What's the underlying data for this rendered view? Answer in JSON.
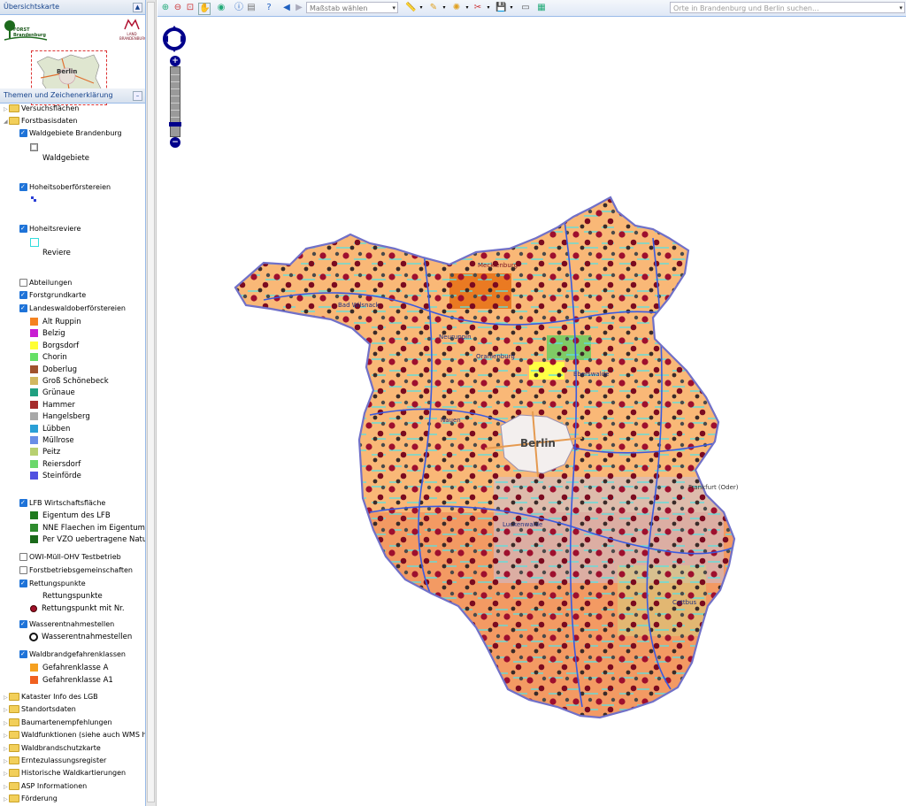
{
  "overview": {
    "title": "Übersichtskarte",
    "logo_forst_text": "FORST Brandenburg",
    "logo_unesco_text": "LAND BRANDENBURG",
    "mini_city": "Berlin"
  },
  "themes": {
    "title": "Themen und Zeichenerklärung"
  },
  "tree": [
    {
      "type": "folder",
      "label": "Versuchsflächen",
      "expanded": false
    },
    {
      "type": "folder",
      "label": "Forstbasisdaten",
      "expanded": true
    },
    {
      "type": "layer",
      "label": "Waldgebiete Brandenburg",
      "checked": true
    },
    {
      "type": "legend",
      "label": "Waldgebiete",
      "color": "#ffffff",
      "border": "#777777"
    },
    {
      "type": "layer",
      "label": "Hoheitsoberförstereien",
      "checked": true
    },
    {
      "type": "layer",
      "label": "Hoheitsreviere",
      "checked": true
    },
    {
      "type": "legend",
      "label": "Reviere",
      "color": "#ffffff",
      "border": "#33dddd"
    },
    {
      "type": "layer",
      "label": "Abteilungen",
      "checked": false
    },
    {
      "type": "layer",
      "label": "Forstgrundkarte",
      "checked": true
    },
    {
      "type": "layer",
      "label": "Landeswaldoberförstereien",
      "checked": true
    }
  ],
  "landeswald_legend": [
    {
      "label": "Alt Ruppin",
      "color": "#f58220"
    },
    {
      "label": "Belzig",
      "color": "#c81ed2"
    },
    {
      "label": "Borgsdorf",
      "color": "#ffff33"
    },
    {
      "label": "Chorin",
      "color": "#66e066"
    },
    {
      "label": "Doberlug",
      "color": "#a0522d"
    },
    {
      "label": "Groß Schönebeck",
      "color": "#d2b860"
    },
    {
      "label": "Grünaue",
      "color": "#20a080"
    },
    {
      "label": "Hammer",
      "color": "#a52a2a"
    },
    {
      "label": "Hangelsberg",
      "color": "#a8a8a8"
    },
    {
      "label": "Lübben",
      "color": "#2a9fd6"
    },
    {
      "label": "Müllrose",
      "color": "#6a8ee6"
    },
    {
      "label": "Peitz",
      "color": "#b8d070"
    },
    {
      "label": "Reiersdorf",
      "color": "#6ad86a"
    },
    {
      "label": "Steinförde",
      "color": "#5050e0"
    }
  ],
  "lfb": {
    "layer": "LFB Wirtschaftsfläche",
    "items": [
      {
        "label": "Eigentum des LFB",
        "color": "#1e7a1e"
      },
      {
        "label": "NNE Flaechen im Eigentum",
        "color": "#2e8b2e"
      },
      {
        "label": "Per VZO uebertragene Natu",
        "color": "#1a6a1a"
      }
    ]
  },
  "more_layers": [
    {
      "label": "OWI-Müll-OHV Testbetrieb",
      "checked": false
    },
    {
      "label": "Forstbetriebsgemeinschaften",
      "checked": false
    },
    {
      "label": "Rettungspunkte",
      "checked": true
    }
  ],
  "rettung": {
    "legend_title": "Rettungspunkte",
    "legend_item": "Rettungspunkt mit Nr."
  },
  "wasser": {
    "layer": "Wasserentnahmestellen",
    "legend_item": "Wasserentnahmestellen"
  },
  "waldbrand": {
    "layer": "Waldbrandgefahrenklassen",
    "items": [
      {
        "label": "Gefahrenklasse A",
        "color": "#f5a020"
      },
      {
        "label": "Gefahrenklasse A1",
        "color": "#f06020"
      }
    ]
  },
  "folders_bottom": [
    "Kataster Info des LGB",
    "Standortsdaten",
    "Baumartenempfehlungen",
    "Waldfunktionen (siehe auch WMS hinz",
    "Waldbrandschutzkarte",
    "Erntezulassungsregister",
    "Historische Waldkartierungen",
    "ASP Informationen",
    "Förderung"
  ],
  "toolbar": {
    "scale_placeholder": "Maßstab wählen",
    "search_placeholder": "Orte in Brandenburg und Berlin suchen..."
  },
  "map": {
    "city": "Berlin",
    "labels": [
      "Mecklenburg",
      "Bad Wilsnack",
      "Neuruppin",
      "Eberswalde",
      "Oranienburg",
      "Frankfurt (Oder)",
      "Cottbus",
      "Luckenwalde",
      "Nauen"
    ]
  },
  "colors": {
    "accent": "#15428b",
    "panel_border": "#99bbe8",
    "nav_blue": "#00008b"
  }
}
